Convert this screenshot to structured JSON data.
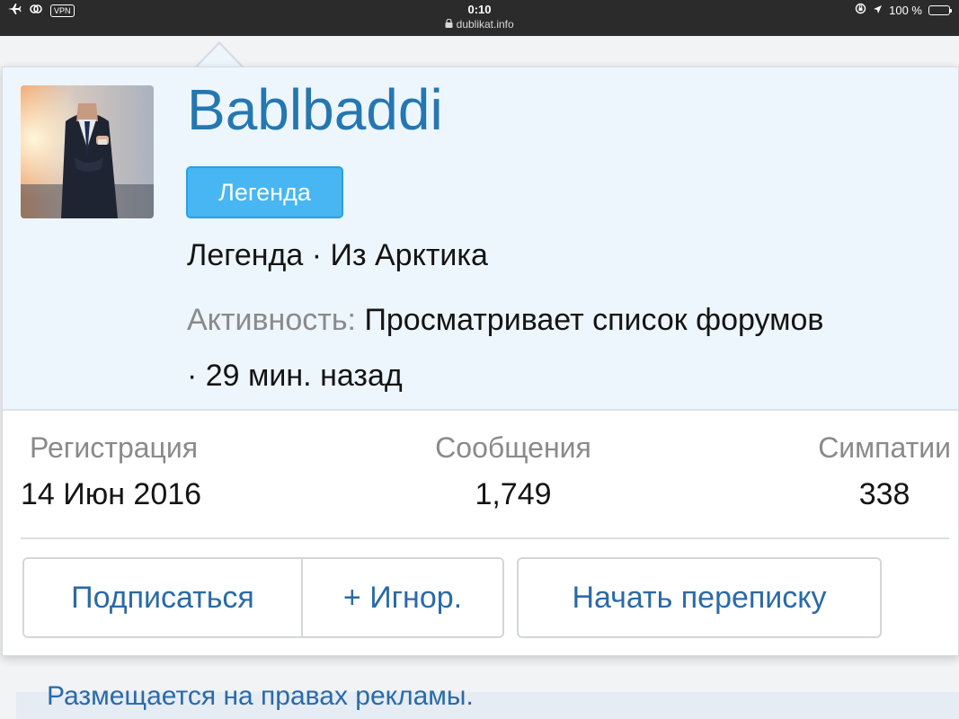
{
  "statusbar": {
    "vpn_label": "VPN",
    "time": "0:10",
    "url": "dublikat.info",
    "battery_text": "100 %",
    "battery_level": 1.0
  },
  "background": {
    "ad_text": "Размещается на правах рекламы."
  },
  "profile": {
    "username": "Bablbaddi",
    "badge": "Легенда",
    "title_location": "Легенда · Из Арктика",
    "activity_label": "Активность:",
    "activity_value": "Просматривает список форумов · 29 мин. назад"
  },
  "stats": {
    "registration_label": "Регистрация",
    "registration_value": "14 Июн 2016",
    "messages_label": "Сообщения",
    "messages_value": "1,749",
    "likes_label": "Симпатии",
    "likes_value": "338"
  },
  "actions": {
    "follow": "Подписаться",
    "ignore": "+ Игнор.",
    "start_conversation": "Начать переписку"
  },
  "colors": {
    "username": "#2577b1",
    "badge_bg": "#47b6f3",
    "link": "#2a6aa6",
    "header_bg": "#edf6fd"
  }
}
